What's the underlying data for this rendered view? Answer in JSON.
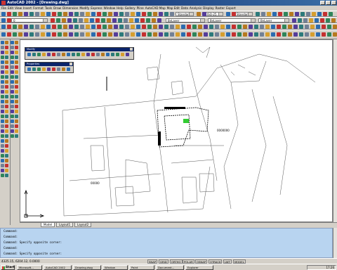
{
  "window": {
    "title": "AutoCAD 2002 - [Drawing.dwg]"
  },
  "menu": [
    "File",
    "Edit",
    "View",
    "Insert",
    "Format",
    "Tools",
    "Draw",
    "Dimension",
    "Modify",
    "Express",
    "Window",
    "Help",
    "Gallery",
    "Pline",
    "AutoCAD Map",
    "Map Edit",
    "Data",
    "Analysis",
    "Display",
    "Raster",
    "Export"
  ],
  "styles": {
    "text_style": "Standard",
    "dim_style": "ISO-25",
    "table_style": "Standard"
  },
  "layers": {
    "current": "0",
    "color": "ByLayer",
    "linetype": "ByLayer",
    "lineweight": "ByLayer"
  },
  "palettes": [
    {
      "title": "Modify"
    },
    {
      "title": "Properties"
    }
  ],
  "layout_tabs": [
    "Model",
    "Layout1",
    "Layout2"
  ],
  "command_lines": [
    "Command:",
    "Command:",
    "Command:  Specify opposite corner:",
    "Command:",
    "Command:  Specify opposite corner:"
  ],
  "status": {
    "coords": "4325.15, 6204.12, 0.0000",
    "buttons": [
      "SNAP",
      "GRID",
      "ORTHO",
      "POLAR",
      "OSNAP",
      "OTRACK",
      "LWT",
      "MODEL"
    ]
  },
  "taskbar": {
    "start": "Start",
    "tasks": [
      "Microsoft...",
      "AutoCAD 2002",
      "Drawing.dwg",
      "Window",
      "Paint",
      "Document...",
      "Explorer"
    ],
    "clock": "17:26"
  },
  "drawing": {
    "annotation_1": "0000000",
    "annotation_2": "00000"
  },
  "colors": {
    "command_bg": "#b8d4f0",
    "title_bar": "#0a246a",
    "canvas": "#ffffff"
  }
}
